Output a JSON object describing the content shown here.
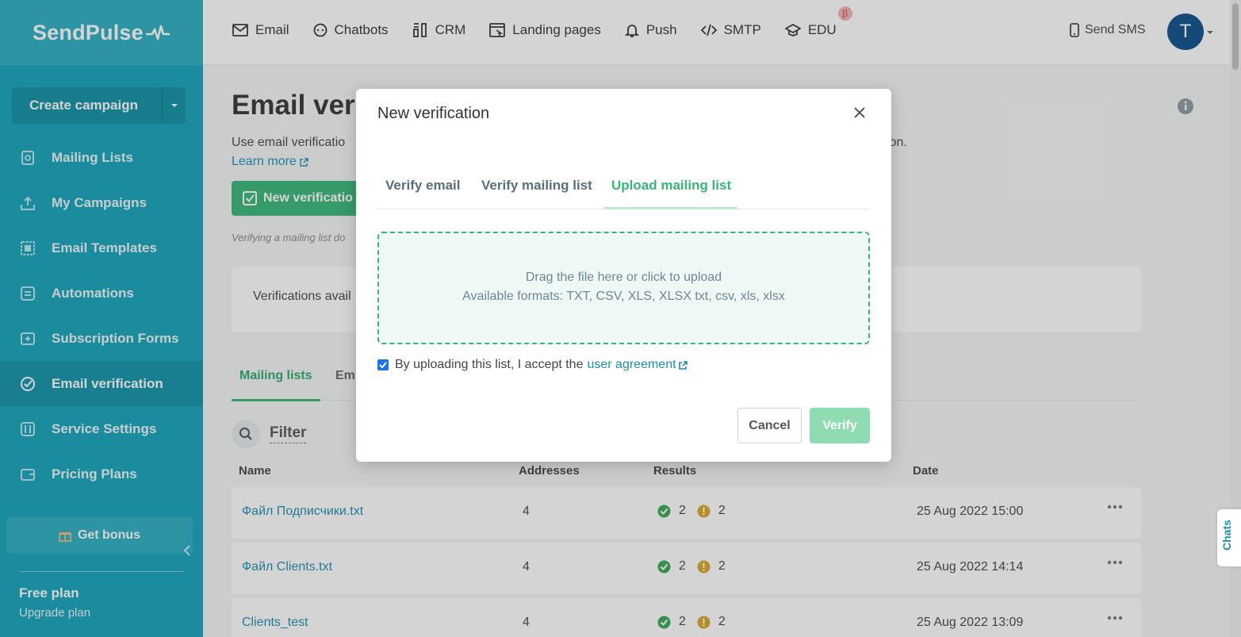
{
  "sidebar": {
    "logo": "SendPulse",
    "create_label": "Create campaign",
    "items": [
      {
        "label": "Mailing Lists"
      },
      {
        "label": "My Campaigns"
      },
      {
        "label": "Email Templates"
      },
      {
        "label": "Automations"
      },
      {
        "label": "Subscription Forms"
      },
      {
        "label": "Email verification"
      },
      {
        "label": "Service Settings"
      },
      {
        "label": "Pricing Plans"
      }
    ],
    "bonus": "Get bonus",
    "plan_title": "Free plan",
    "plan_link": "Upgrade plan"
  },
  "header": {
    "menu": [
      {
        "label": "Email",
        "icon": "envelope-icon"
      },
      {
        "label": "Chatbots",
        "icon": "chat-icon"
      },
      {
        "label": "CRM",
        "icon": "crm-icon"
      },
      {
        "label": "Landing pages",
        "icon": "landing-icon"
      },
      {
        "label": "Push",
        "icon": "bell-icon"
      },
      {
        "label": "SMTP",
        "icon": "code-icon"
      },
      {
        "label": "EDU",
        "icon": "graduation-cap-icon"
      }
    ],
    "beta": "β",
    "sms": "Send SMS",
    "avatar": "T"
  },
  "page": {
    "title": "Email veri",
    "desc": "Use email verificatio",
    "desc_tail": "rmation.",
    "learn_more": "Learn more",
    "new_button": "New verificatio",
    "note": "Verifying a mailing list do",
    "verifications": "Verifications avail",
    "tabs": [
      "Mailing lists",
      "Em"
    ],
    "filter": "Filter",
    "columns": {
      "name": "Name",
      "addresses": "Addresses",
      "results": "Results",
      "date": "Date"
    },
    "rows": [
      {
        "name": "Файл Подписчики.txt",
        "addresses": "4",
        "valid": "2",
        "warn": "2",
        "date": "25 Aug 2022 15:00"
      },
      {
        "name": "Файл Clients.txt",
        "addresses": "4",
        "valid": "2",
        "warn": "2",
        "date": "25 Aug 2022 14:14"
      },
      {
        "name": "Clients_test",
        "addresses": "4",
        "valid": "2",
        "warn": "2",
        "date": "25 Aug 2022 13:09"
      }
    ]
  },
  "chats": "Chats",
  "modal": {
    "title": "New verification",
    "tabs": [
      "Verify email",
      "Verify mailing list",
      "Upload mailing list"
    ],
    "active_tab": "Upload mailing list",
    "drop_line1": "Drag the file here or click to upload",
    "drop_line2": "Available formats: TXT, CSV, XLS, XLSX txt, csv, xls, xlsx",
    "agree_text": "By uploading this list, I accept the",
    "agree_link": "user agreement",
    "agree_checked": true,
    "cancel": "Cancel",
    "verify": "Verify"
  },
  "colors": {
    "sidebar": "#12a3b9",
    "accent_green": "#36b776",
    "link": "#1c8db0",
    "avatar": "#0b4f8a"
  }
}
